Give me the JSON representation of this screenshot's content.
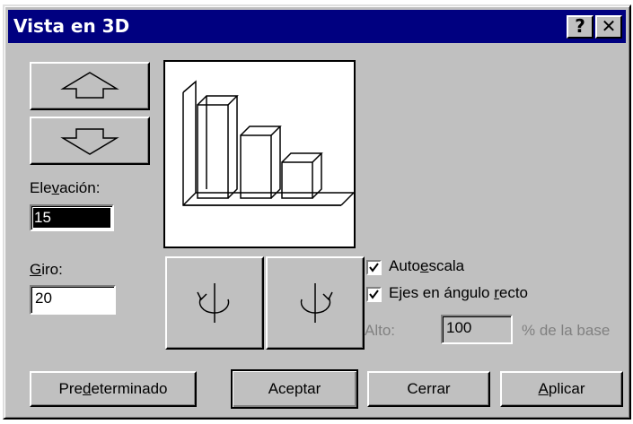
{
  "dialog": {
    "title": "Vista en 3D",
    "help_label": "?",
    "close_label": "✕"
  },
  "elevation": {
    "prefix": "Ele",
    "accel": "v",
    "suffix": "ación:",
    "value": "15"
  },
  "rotation": {
    "accel": "G",
    "suffix": "iro:",
    "value": "20"
  },
  "options": {
    "autoscale": {
      "prefix": "Auto",
      "accel": "e",
      "suffix": "scala",
      "checked": true
    },
    "right_angle": {
      "prefix": "Ejes en ángulo ",
      "accel": "r",
      "suffix": "ecto",
      "checked": true
    },
    "height": {
      "label": "Alto:",
      "value": "100",
      "unit": "% de la base"
    }
  },
  "buttons": {
    "default": {
      "prefix": "Pre",
      "accel": "d",
      "suffix": "eterminado"
    },
    "ok": "Aceptar",
    "close": "Cerrar",
    "apply": {
      "accel": "A",
      "suffix": "plicar"
    }
  },
  "icons": [
    "arrow-up-icon",
    "arrow-down-icon",
    "rotate-left-icon",
    "rotate-right-icon",
    "checkmark-icon"
  ]
}
